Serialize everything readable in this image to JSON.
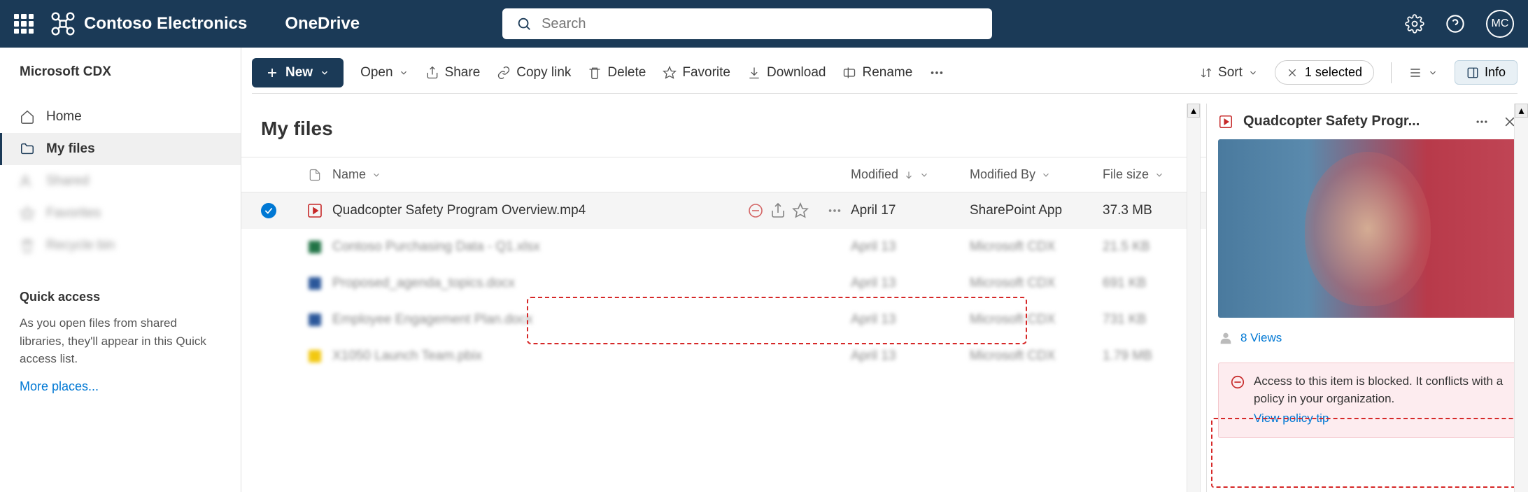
{
  "header": {
    "brand": "Contoso Electronics",
    "app": "OneDrive",
    "search_placeholder": "Search",
    "avatar_initials": "MC"
  },
  "sidebar": {
    "tenant": "Microsoft CDX",
    "items": [
      {
        "label": "Home",
        "icon": "home",
        "active": false,
        "blurred": false
      },
      {
        "label": "My files",
        "icon": "folder",
        "active": true,
        "blurred": false
      },
      {
        "label": "Shared",
        "icon": "people",
        "active": false,
        "blurred": true
      },
      {
        "label": "Favorites",
        "icon": "star",
        "active": false,
        "blurred": true
      },
      {
        "label": "Recycle bin",
        "icon": "trash",
        "active": false,
        "blurred": true
      }
    ],
    "quick_access": {
      "title": "Quick access",
      "description": "As you open files from shared libraries, they'll appear in this Quick access list.",
      "more": "More places..."
    }
  },
  "toolbar": {
    "new": "New",
    "open": "Open",
    "share": "Share",
    "copy_link": "Copy link",
    "delete": "Delete",
    "favorite": "Favorite",
    "download": "Download",
    "rename": "Rename",
    "sort": "Sort",
    "selected": "1 selected",
    "info": "Info"
  },
  "page": {
    "title": "My files"
  },
  "columns": {
    "name": "Name",
    "modified": "Modified",
    "modified_by": "Modified By",
    "file_size": "File size"
  },
  "files": [
    {
      "name": "Quadcopter Safety Program Overview.mp4",
      "modified": "April 17",
      "modified_by": "SharePoint App",
      "size": "37.3 MB",
      "selected": true,
      "blurred": false,
      "type": "video"
    },
    {
      "name": "Contoso Purchasing Data - Q1.xlsx",
      "modified": "April 13",
      "modified_by": "Microsoft CDX",
      "size": "21.5 KB",
      "selected": false,
      "blurred": true,
      "type": "xlsx"
    },
    {
      "name": "Proposed_agenda_topics.docx",
      "modified": "April 13",
      "modified_by": "Microsoft CDX",
      "size": "691 KB",
      "selected": false,
      "blurred": true,
      "type": "docx"
    },
    {
      "name": "Employee Engagement Plan.docx",
      "modified": "April 13",
      "modified_by": "Microsoft CDX",
      "size": "731 KB",
      "selected": false,
      "blurred": true,
      "type": "docx"
    },
    {
      "name": "X1050 Launch Team.pbix",
      "modified": "April 13",
      "modified_by": "Microsoft CDX",
      "size": "1.79 MB",
      "selected": false,
      "blurred": true,
      "type": "pbix"
    }
  ],
  "info_panel": {
    "title": "Quadcopter Safety Progr...",
    "views": "8 Views",
    "policy_text": "Access to this item is blocked. It conflicts with a policy in your organization.",
    "policy_link": "View policy tip"
  }
}
